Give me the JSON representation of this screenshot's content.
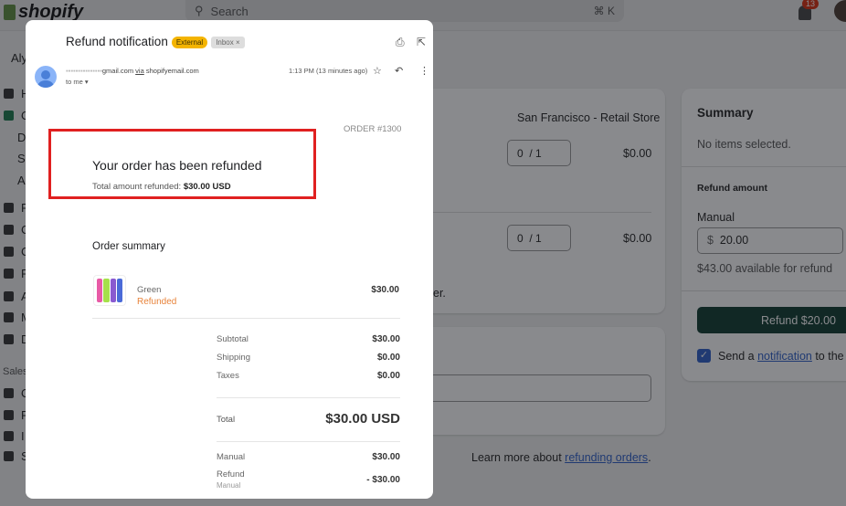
{
  "topbar": {
    "brand": "shopify",
    "search_placeholder": "Search",
    "shortcut": "⌘ K",
    "notification_count": "13"
  },
  "sidebar": {
    "store_initial": "Aly",
    "items": [
      "H",
      "O",
      "D",
      "S",
      "A",
      "P",
      "C",
      "C",
      "F",
      "A",
      "M",
      "D"
    ],
    "section": "Sales",
    "sales_items": [
      "O",
      "P",
      "I",
      "S"
    ]
  },
  "refund_page": {
    "location": "San Francisco - Retail Store",
    "line_items": [
      {
        "qty": "0",
        "max": "/ 1",
        "amount": "$0.00"
      },
      {
        "qty": "0",
        "max": "/ 1",
        "amount": "$0.00"
      }
    ],
    "partial_text": "er.",
    "learn_more_prefix": "Learn more about ",
    "learn_more_link": "refunding orders",
    "learn_more_suffix": ".",
    "summary": {
      "title": "Summary",
      "empty": "No items selected.",
      "refund_amount_label": "Refund amount",
      "manual_label": "Manual",
      "currency": "$",
      "manual_value": "20.00",
      "available": "$43.00 available for refund",
      "refund_button": "Refund $20.00",
      "send_prefix": "Send a ",
      "send_link": "notification",
      "send_suffix": " to the c",
      "send_checked": true
    }
  },
  "email": {
    "subject": "Refund notification",
    "label_external": "External",
    "label_inbox": "Inbox ×",
    "sender_suffix": "gmail.com",
    "via": "via",
    "via_domain": "shopifyemail.com",
    "time": "1:13 PM (13 minutes ago)",
    "to": "to me ▾",
    "order_number": "ORDER #1300",
    "heading": "Your order has been refunded",
    "total_refunded_label": "Total amount refunded: ",
    "total_refunded_value": "$30.00 USD",
    "order_summary": "Order summary",
    "item": {
      "variant": "Green",
      "status": "Refunded",
      "price": "$30.00"
    },
    "totals": [
      {
        "label": "Subtotal",
        "value": "$30.00"
      },
      {
        "label": "Shipping",
        "value": "$0.00"
      },
      {
        "label": "Taxes",
        "value": "$0.00"
      }
    ],
    "total_label": "Total",
    "total_value": "$30.00 USD",
    "payments": [
      {
        "label": "Manual",
        "value": "$30.00"
      },
      {
        "label": "Refund",
        "sub": "Manual",
        "value": "- $30.00"
      }
    ]
  },
  "colors": {
    "highlight_box": "#e02020",
    "refunded": "#e8833a",
    "external_label": "#f4b400",
    "primary_button": "#0e3a2f"
  }
}
